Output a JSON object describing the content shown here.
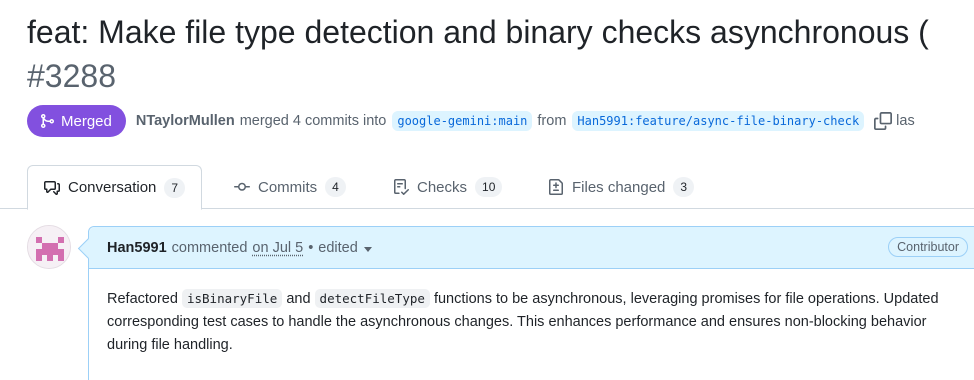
{
  "pr": {
    "title": "feat: Make file type detection and binary checks asynchronous (",
    "number": "#3288",
    "status_label": "Merged",
    "author": "NTaylorMullen",
    "action_text": "merged 4 commits into",
    "base_branch": "google-gemini:main",
    "from_text": "from",
    "head_branch": "Han5991:feature/async-file-binary-check",
    "trailing_text": "las"
  },
  "tabs": [
    {
      "label": "Conversation",
      "count": "7",
      "icon": "comment-discussion-icon"
    },
    {
      "label": "Commits",
      "count": "4",
      "icon": "git-commit-icon"
    },
    {
      "label": "Checks",
      "count": "10",
      "icon": "checklist-icon"
    },
    {
      "label": "Files changed",
      "count": "3",
      "icon": "file-diff-icon"
    }
  ],
  "comment": {
    "author": "Han5991",
    "verb": "commented",
    "date": "on Jul 5",
    "separator": "•",
    "edited": "edited",
    "role": "Contributor",
    "body_part1": "Refactored",
    "code1": "isBinaryFile",
    "body_part2": "and",
    "code2": "detectFileType",
    "body_part3": "functions to be asynchronous, leveraging promises for file operations. Updated corresponding test cases to handle the asynchronous changes. This enhances performance and ensures non-blocking behavior during file handling."
  },
  "colors": {
    "merged_purple": "#8250df",
    "link_blue": "#0969da",
    "comment_header_bg": "#ddf4ff",
    "comment_border": "#9cd0f7"
  }
}
